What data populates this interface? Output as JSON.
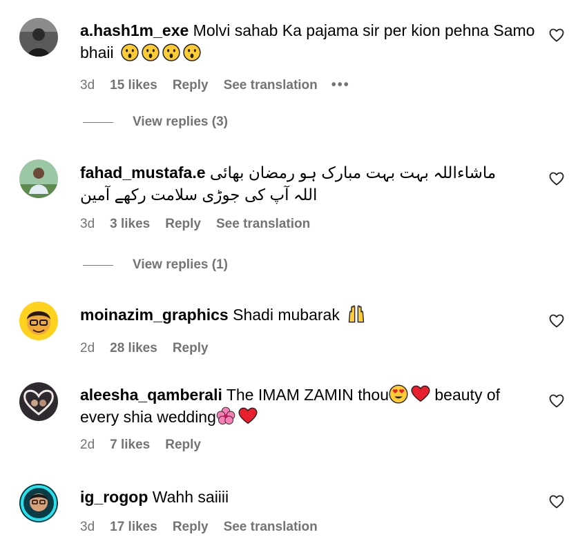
{
  "comments": [
    {
      "username": "a.hash1m_exe",
      "text": "Molvi sahab Ka pajama sir per kion pehna Samo bhaii",
      "time": "3d",
      "likes": "15 likes",
      "reply": "Reply",
      "translation": "See translation",
      "more": "•••",
      "emoji": [
        "hushed-face",
        "hushed-face",
        "hushed-face",
        "hushed-face"
      ],
      "view_replies": "View replies (3)"
    },
    {
      "username": "fahad_mustafa.e",
      "text_line1": "ماشاءاللہ بہت بہت مبارک ہو رمضان بھائی",
      "text_line2": "اللہ آپ کی جوڑی سلامت رکھے آمین",
      "time": "3d",
      "likes": "3 likes",
      "reply": "Reply",
      "translation": "See translation",
      "view_replies": "View replies (1)"
    },
    {
      "username": "moinazim_graphics",
      "text": "Shadi mubarak",
      "time": "2d",
      "likes": "28 likes",
      "reply": "Reply",
      "emoji": [
        "raising-hands"
      ]
    },
    {
      "username": "aleesha_qamberali",
      "text_part1": "The IMAM ZAMIN thou",
      "text_part2": "beauty of every shia wedding",
      "time": "2d",
      "likes": "7 likes",
      "reply": "Reply",
      "emoji": [
        "heart-eyes-face",
        "red-heart",
        "hibiscus",
        "red-heart"
      ]
    },
    {
      "username": "ig_rogop",
      "text": "Wahh saiiii",
      "time": "3d",
      "likes": "17 likes",
      "reply": "Reply",
      "translation": "See translation"
    }
  ],
  "icons": {
    "like": "heart-outline-icon"
  },
  "colors": {
    "meta": "#737373",
    "text": "#000000"
  }
}
